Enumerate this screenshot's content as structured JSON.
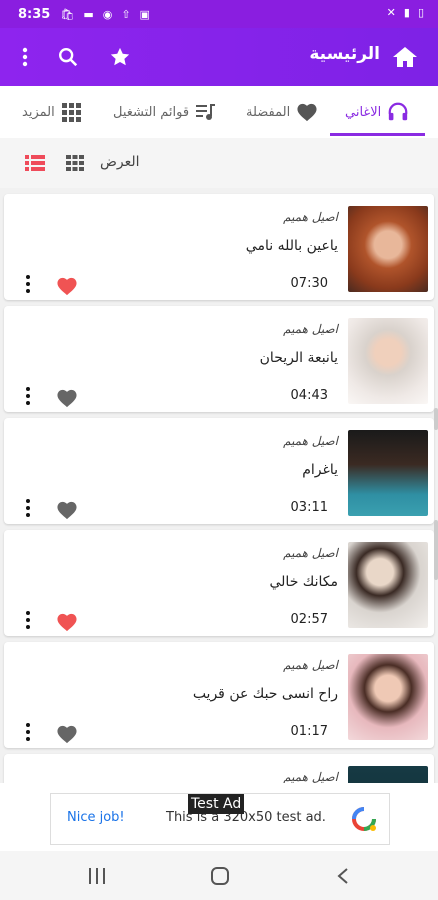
{
  "status_bar": {
    "time": "8:35"
  },
  "app_bar": {
    "title": "الرئيسية",
    "accent": "#8a24ea"
  },
  "tabs": [
    {
      "label": "الاغاني",
      "icon": "headphones-icon",
      "active": true
    },
    {
      "label": "المفضلة",
      "icon": "heart-icon",
      "active": false
    },
    {
      "label": "قوائم التشغيل",
      "icon": "playlist-icon",
      "active": false
    },
    {
      "label": "المزيد",
      "icon": "grid-icon",
      "active": false
    }
  ],
  "view": {
    "label": "العرض"
  },
  "songs": [
    {
      "artist": "اصيل هميم",
      "title": "ياعين بالله نامي",
      "duration": "07:30",
      "favorite": true
    },
    {
      "artist": "اصيل هميم",
      "title": "يانبعة الريحان",
      "duration": "04:43",
      "favorite": false
    },
    {
      "artist": "اصيل هميم",
      "title": "ياغرام",
      "duration": "03:11",
      "favorite": false
    },
    {
      "artist": "اصيل هميم",
      "title": "مكانك خالي",
      "duration": "02:57",
      "favorite": true
    },
    {
      "artist": "اصيل هميم",
      "title": "راح انسى حبك عن قريب",
      "duration": "01:17",
      "favorite": false
    },
    {
      "artist": "اصيل هميم",
      "title": "",
      "duration": "",
      "favorite": false
    }
  ],
  "ad": {
    "badge": "Test Ad",
    "cta": "Nice job!",
    "text": "This is a 320x50 test ad."
  },
  "colors": {
    "heart_on": "#f05353",
    "heart_off": "#666666"
  }
}
